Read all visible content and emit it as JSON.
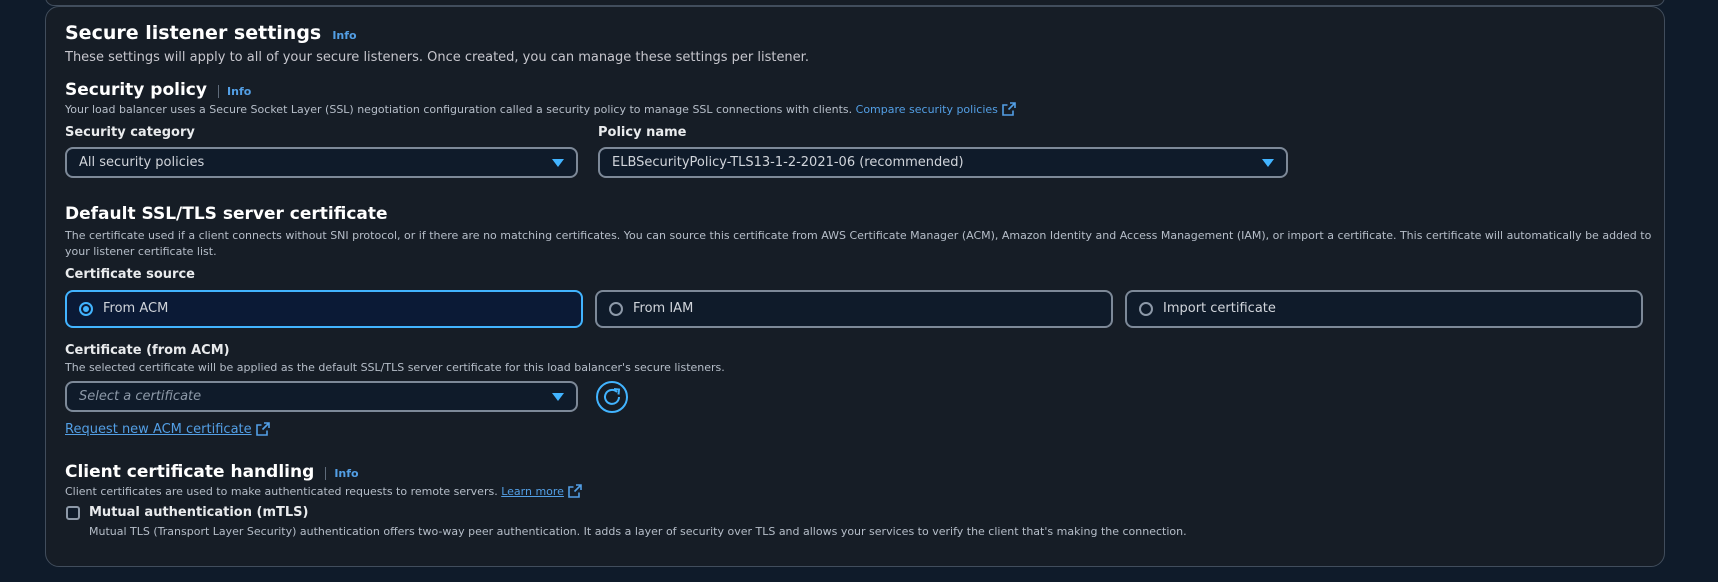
{
  "secure_listener": {
    "title": "Secure listener settings",
    "info": "Info",
    "description": "These settings will apply to all of your secure listeners. Once created, you can manage these settings per listener."
  },
  "security_policy": {
    "title": "Security policy",
    "info": "Info",
    "description": "Your load balancer uses a Secure Socket Layer (SSL) negotiation configuration called a security policy to manage SSL connections with clients.",
    "compare_link": "Compare security policies",
    "category_label": "Security category",
    "category_value": "All security policies",
    "policy_label": "Policy name",
    "policy_value": "ELBSecurityPolicy-TLS13-1-2-2021-06 (recommended)"
  },
  "default_cert": {
    "title": "Default SSL/TLS server certificate",
    "description_line1": "The certificate used if a client connects without SNI protocol, or if there are no matching certificates. You can source this certificate from AWS Certificate Manager (ACM), Amazon Identity and Access Management (IAM), or import a certificate. This certificate will automatically be added to",
    "description_line2": "your listener certificate list.",
    "source_label": "Certificate source",
    "options": [
      {
        "label": "From ACM",
        "selected": true
      },
      {
        "label": "From IAM",
        "selected": false
      },
      {
        "label": "Import certificate",
        "selected": false
      }
    ],
    "acm_label": "Certificate (from ACM)",
    "acm_description": "The selected certificate will be applied as the default SSL/TLS server certificate for this load balancer's secure listeners.",
    "acm_placeholder": "Select a certificate",
    "request_link": "Request new ACM certificate"
  },
  "client_cert": {
    "title": "Client certificate handling",
    "info": "Info",
    "description": "Client certificates are used to make authenticated requests to remote servers.",
    "learn_more": "Learn more",
    "mtls_label": "Mutual authentication (mTLS)",
    "mtls_checked": false,
    "mtls_description": "Mutual TLS (Transport Layer Security) authentication offers two-way peer authentication. It adds a layer of security over TLS and allows your services to verify the client that's making the connection."
  },
  "colors": {
    "background": "#0f1b2a",
    "panel": "#161d26",
    "accent": "#42b4ff",
    "link": "#539fe5"
  },
  "icons": [
    "external-link-icon",
    "caret-down-icon",
    "refresh-icon",
    "radio-icon",
    "checkbox-icon"
  ]
}
